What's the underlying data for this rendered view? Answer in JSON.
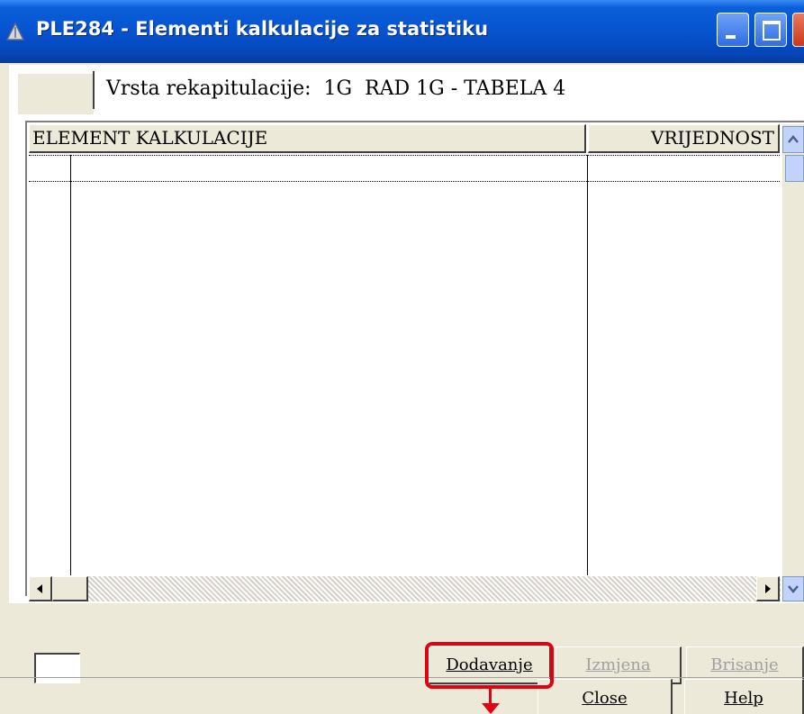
{
  "window": {
    "title": "PLE284 - Elementi kalkulacije za statistiku",
    "title_icon": "app-icon-triangle"
  },
  "header": {
    "label": "Vrsta rekapitulacije:",
    "value": "1G  RAD 1G - TABELA 4"
  },
  "grid": {
    "columns": [
      "ELEMENT KALKULACIJE",
      "VRIJEDNOST"
    ],
    "rows": []
  },
  "buttons": {
    "dodavanje": "Dodavanje",
    "izmjena": "Izmjena",
    "brisanje": "Brisanje",
    "close": "Close",
    "help": "Help"
  },
  "annotation": {
    "highlight_color": "#e5000e",
    "target": "dodavanje"
  }
}
